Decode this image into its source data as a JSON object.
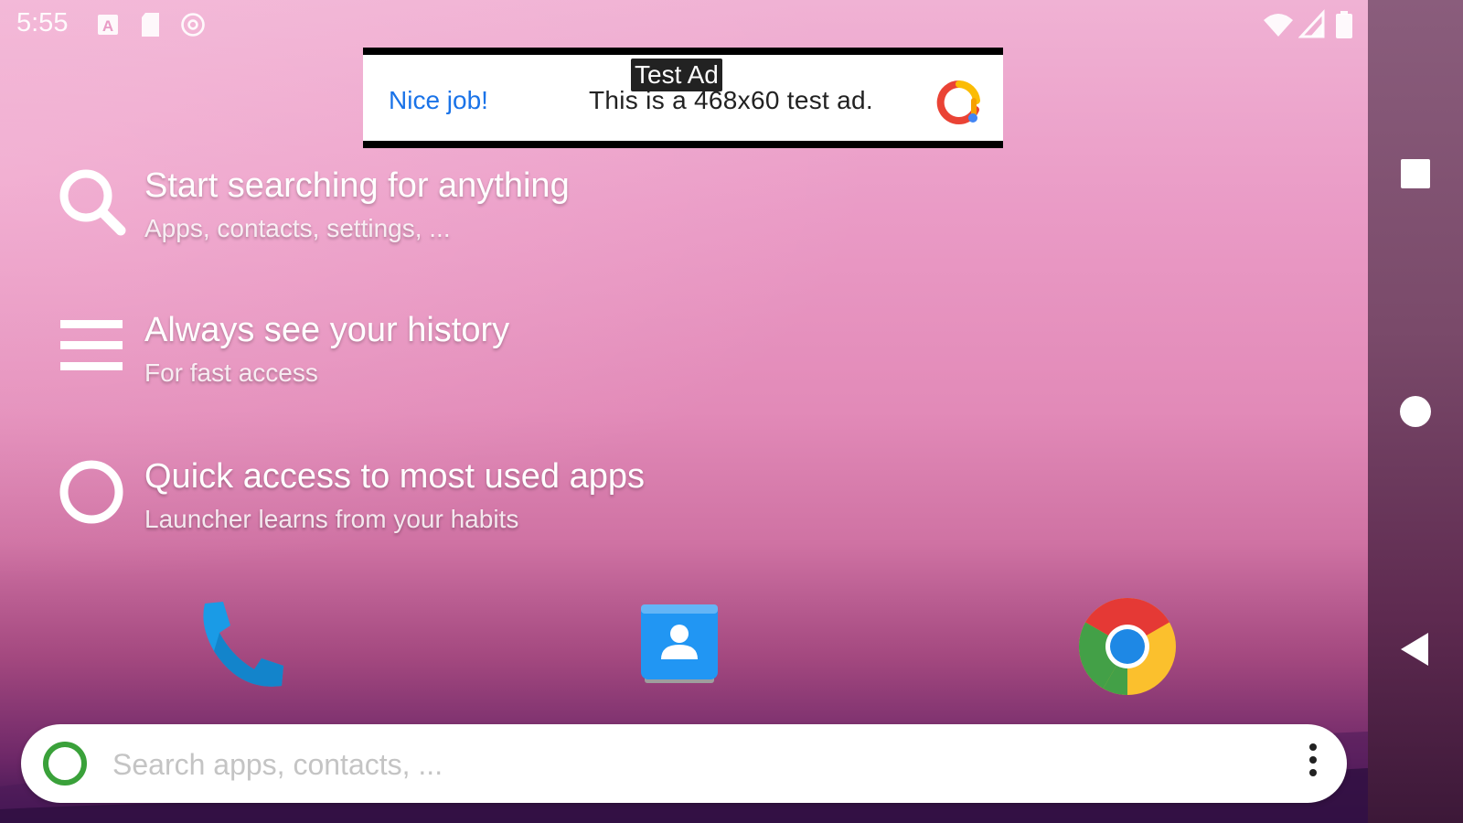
{
  "status_bar": {
    "time": "5:55",
    "left_icons": [
      "keyboard-a-icon",
      "sd-card-icon",
      "sync-at-icon"
    ],
    "right_icons": [
      "wifi-icon",
      "cell-signal-icon",
      "battery-icon"
    ]
  },
  "ad": {
    "tag": "Test Ad",
    "cta": "Nice job!",
    "text": "This is a 468x60 test ad.",
    "logo_icon": "admob-logo-icon"
  },
  "features": [
    {
      "icon": "search-icon",
      "title": "Start searching for anything",
      "subtitle": "Apps, contacts, settings, ..."
    },
    {
      "icon": "history-list-icon",
      "title": "Always see your history",
      "subtitle": "For fast access"
    },
    {
      "icon": "circle-icon",
      "title": "Quick access to most used apps",
      "subtitle": "Launcher learns from your habits"
    }
  ],
  "dock": {
    "apps": [
      "phone-app-icon",
      "contacts-app-icon",
      "chrome-app-icon"
    ]
  },
  "search": {
    "placeholder": "Search apps, contacts, ...",
    "value": ""
  },
  "nav_bar": {
    "buttons": [
      "recents-square-icon",
      "home-circle-icon",
      "back-triangle-icon"
    ]
  },
  "colors": {
    "search_ring": "#3aa13a",
    "ad_cta": "#1a73e8",
    "phone_icon": "#1a9be6",
    "contacts_icon": "#2196f3"
  }
}
